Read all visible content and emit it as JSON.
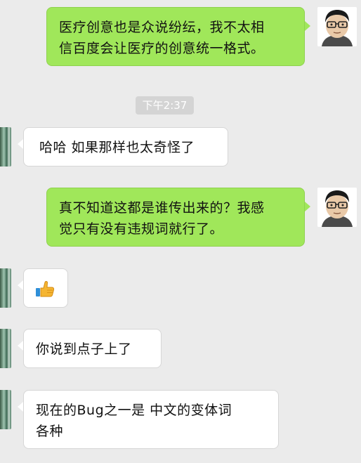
{
  "timestamp": "下午2:37",
  "messages": [
    {
      "from": "self",
      "lines": [
        "医疗创意也是众说纷纭，我不太相",
        "信百度会让医疗的创意统一格式。"
      ]
    },
    {
      "from": "other",
      "lines": [
        "哈哈  如果那样也太奇怪了"
      ]
    },
    {
      "from": "self",
      "lines": [
        "真不知道这都是谁传出来的？我感",
        "觉只有没有违规词就行了。"
      ]
    },
    {
      "from": "other",
      "emoji": "thumbs-up"
    },
    {
      "from": "other",
      "lines": [
        "你说到点子上了"
      ]
    },
    {
      "from": "other",
      "lines": [
        "现在的Bug之一是  中文的变体词",
        "各种"
      ]
    }
  ],
  "colors": {
    "background": "#ebebeb",
    "outgoing_bubble": "#a0e75a",
    "incoming_bubble": "#ffffff",
    "timestamp_bg": "#d4d4d4"
  }
}
